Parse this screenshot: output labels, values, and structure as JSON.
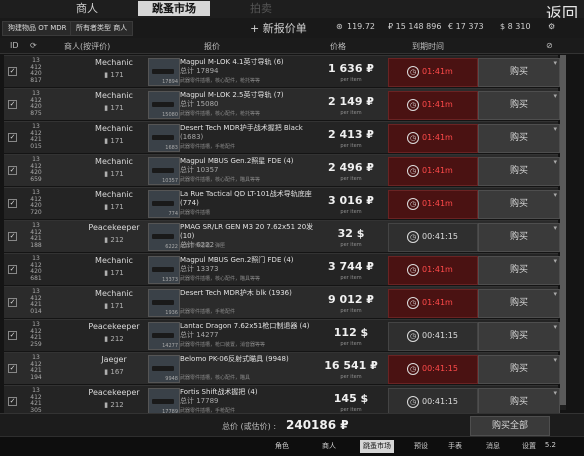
{
  "tabs": {
    "traders": "商人",
    "market": "跳蚤市场",
    "auction": "拍卖",
    "back": "返回"
  },
  "filters": {
    "chip1": "狗建物品 OT MDR",
    "chip2": "所有者类型 商人"
  },
  "add_offer": "+ 新报价单",
  "currencies": {
    "rep": "119.72",
    "rub": "₽ 15 148 896",
    "eur": "€ 17 373",
    "usd": "$ 8 310"
  },
  "header": {
    "id": "ID",
    "seller": "商人(按评价)",
    "offer": "报价",
    "price": "价格",
    "expires": "到期时间"
  },
  "rows": [
    {
      "id": "13\n412\n420\n817",
      "seller": "Mechanic",
      "rep": "171",
      "name": "Magpul M-LOK 4.1英寸导轨 (6)",
      "total": "总计 17894",
      "sub": "武器零件插槽，核心配件，枪托等等",
      "price": "1 636 ₽",
      "per": "per item",
      "expire": "01:41m",
      "red": true,
      "code": "17894"
    },
    {
      "id": "13\n412\n420\n875",
      "seller": "Mechanic",
      "rep": "171",
      "name": "Magpul M-LOK 2.5英寸导轨 (7)",
      "total": "总计 15080",
      "sub": "武器零件插槽，核心配件，枪托等等",
      "price": "2 149 ₽",
      "per": "per item",
      "expire": "01:41m",
      "red": true,
      "code": "15080"
    },
    {
      "id": "13\n412\n421\n015",
      "seller": "Mechanic",
      "rep": "171",
      "name": "Desert Tech MDR护手战术握把 Black",
      "total": "(1683)",
      "sub": "武器零件插槽，手枪配件",
      "price": "2 413 ₽",
      "per": "per item",
      "expire": "01:41m",
      "red": true,
      "code": "1683"
    },
    {
      "id": "13\n412\n420\n659",
      "seller": "Mechanic",
      "rep": "171",
      "name": "Magpul MBUS Gen.2照星 FDE (4)",
      "total": "总计 10357",
      "sub": "武器零件插槽，核心配件，瞄具等等",
      "price": "2 496 ₽",
      "per": "per item",
      "expire": "01:41m",
      "red": true,
      "code": "10357"
    },
    {
      "id": "13\n412\n420\n720",
      "seller": "Mechanic",
      "rep": "171",
      "name": "La Rue Tactical QD LT-101战术导轨底座 (774)",
      "total": "",
      "sub": "武器零件插槽",
      "price": "3 016 ₽",
      "per": "per item",
      "expire": "01:41m",
      "red": true,
      "code": "774"
    },
    {
      "id": "13\n412\n421\n188",
      "seller": "Peacekeeper",
      "rep": "212",
      "name": "PMAG SR/LR GEN M3 20 7.62x51 20发 (10)",
      "total": "总计 6222",
      "sub": "武器零件插槽，弹匣",
      "price": "32 $",
      "per": "per item",
      "expire": "00:41:15",
      "red": false,
      "code": "6222"
    },
    {
      "id": "13\n412\n420\n681",
      "seller": "Mechanic",
      "rep": "171",
      "name": "Magpul MBUS Gen.2照门 FDE (4)",
      "total": "总计 13373",
      "sub": "武器零件插槽，核心配件，瞄具等等",
      "price": "3 744 ₽",
      "per": "per item",
      "expire": "01:41m",
      "red": true,
      "code": "13373"
    },
    {
      "id": "13\n412\n421\n014",
      "seller": "Mechanic",
      "rep": "171",
      "name": "Desert Tech MDR护木 blk (1936)",
      "total": "",
      "sub": "武器零件插槽，手枪配件",
      "price": "9 012 ₽",
      "per": "per item",
      "expire": "01:41m",
      "red": true,
      "code": "1936"
    },
    {
      "id": "13\n412\n421\n259",
      "seller": "Peacekeeper",
      "rep": "212",
      "name": "Lantac Dragon 7.62x51枪口制退器 (4)",
      "total": "总计 14277",
      "sub": "武器零件插槽，枪口装置，消音器等等",
      "price": "112 $",
      "per": "per item",
      "expire": "00:41:15",
      "red": false,
      "code": "14277"
    },
    {
      "id": "13\n412\n421\n194",
      "seller": "Jaeger",
      "rep": "167",
      "name": "Belomo PK-06反射式瞄具 (9948)",
      "total": "",
      "sub": "武器零件插槽，核心配件，瞄具",
      "price": "16 541 ₽",
      "per": "per item",
      "expire": "00:41:15",
      "red": true,
      "code": "9948"
    },
    {
      "id": "13\n412\n421\n305",
      "seller": "Peacekeeper",
      "rep": "212",
      "name": "Fortis Shift战术握把 (4)",
      "total": "总计 17789",
      "sub": "武器零件插槽，手枪配件",
      "price": "145 $",
      "per": "per item",
      "expire": "00:41:15",
      "red": false,
      "code": "17789"
    }
  ],
  "footer": {
    "total_label": "总价 (或估价) :",
    "total_value": "240186 ₽",
    "buy_all": "购买全部"
  },
  "bottom": {
    "nav1": "角色",
    "nav2": "商人",
    "nav3": "跳蚤市场",
    "nav4": "预设",
    "nav5": "手表",
    "nav6": "消息",
    "nav7": "设置",
    "time": "5.2"
  }
}
